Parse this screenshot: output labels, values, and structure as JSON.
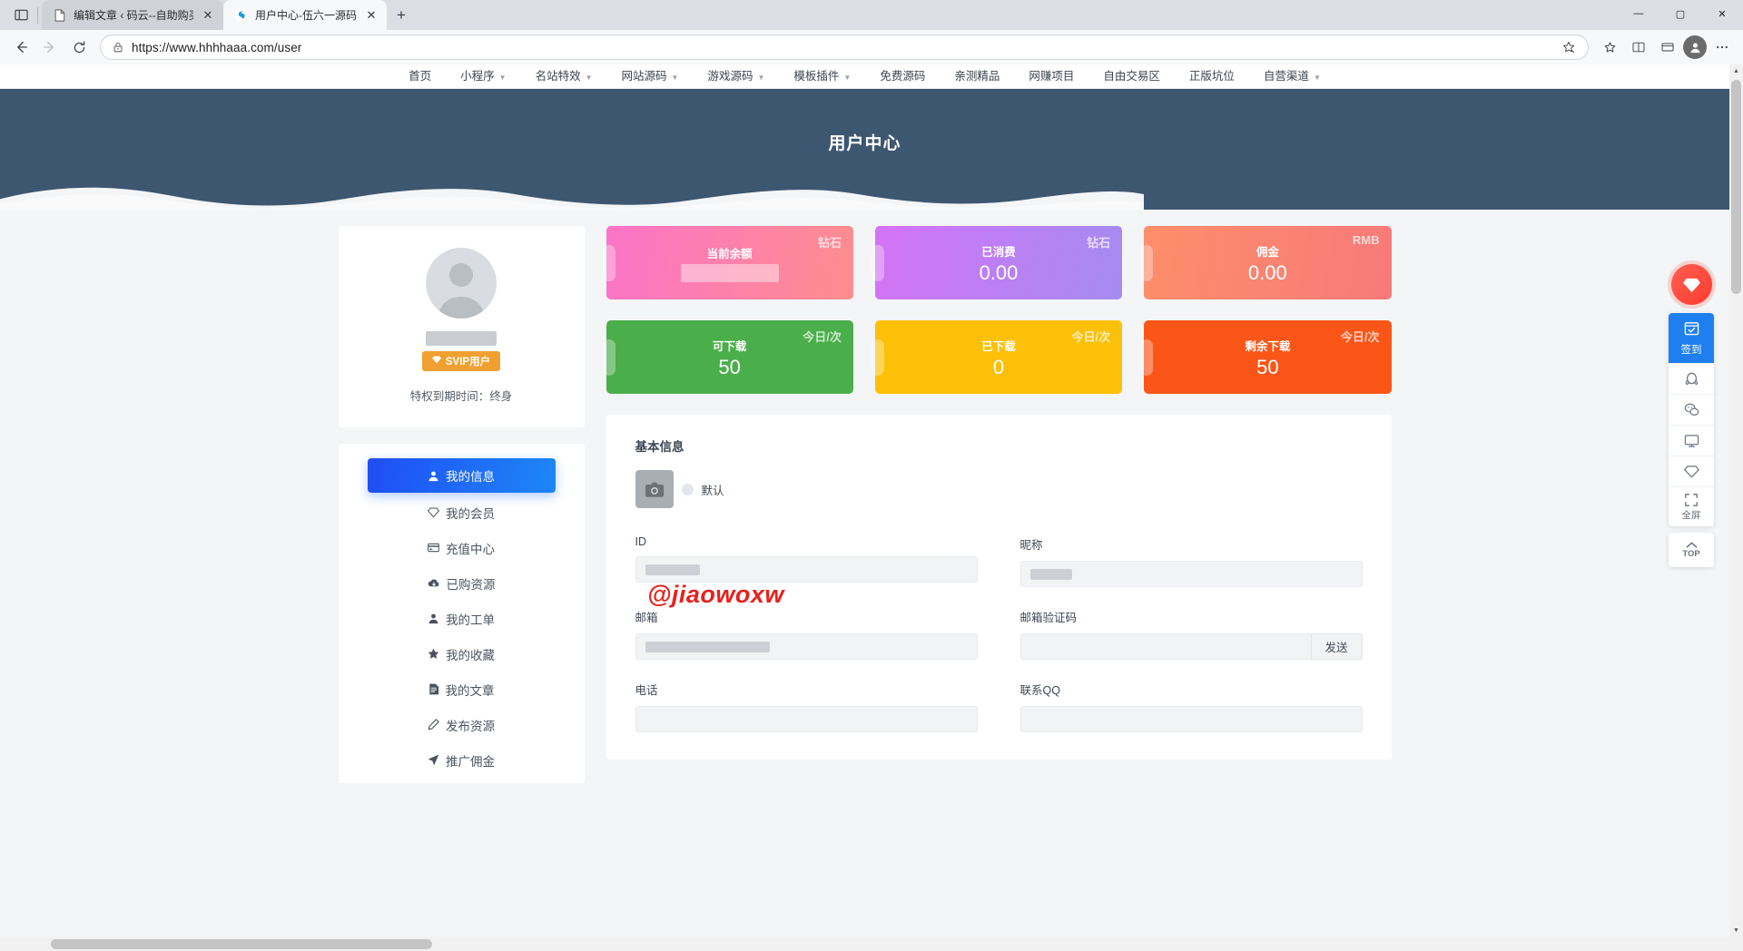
{
  "browser": {
    "tabs": [
      {
        "title": "编辑文章 ‹ 码云--自助购买资源平",
        "favicon": "page-icon",
        "active": false
      },
      {
        "title": "用户中心-伍六一源码",
        "favicon": "site-icon",
        "active": true
      }
    ],
    "new_tab_label": "+",
    "nav": {
      "back": "←",
      "forward": "→",
      "reload": "⟳"
    },
    "url": "https://www.hhhhaaa.com/user",
    "url_scheme": "https://",
    "url_host": "www.hhhhaaa.com",
    "url_path": "/user",
    "window_controls": {
      "minimize": "—",
      "maximize": "▢",
      "close": "✕"
    }
  },
  "sitenav": {
    "items": [
      {
        "label": "首页",
        "has_dropdown": false
      },
      {
        "label": "小程序",
        "has_dropdown": true
      },
      {
        "label": "名站特效",
        "has_dropdown": true
      },
      {
        "label": "网站源码",
        "has_dropdown": true
      },
      {
        "label": "游戏源码",
        "has_dropdown": true
      },
      {
        "label": "模板插件",
        "has_dropdown": true
      },
      {
        "label": "免费源码",
        "has_dropdown": false
      },
      {
        "label": "亲测精品",
        "has_dropdown": false
      },
      {
        "label": "网赚项目",
        "has_dropdown": false
      },
      {
        "label": "自由交易区",
        "has_dropdown": false
      },
      {
        "label": "正版坑位",
        "has_dropdown": false
      },
      {
        "label": "自营渠道",
        "has_dropdown": true
      }
    ]
  },
  "hero": {
    "title": "用户中心",
    "bg_color": "#3e5771"
  },
  "profile": {
    "name_masked": true,
    "badge_label": "SVIP用户",
    "badge_icon": "diamond-icon",
    "badge_color": "#f0a030",
    "expire_text": "特权到期时间：终身"
  },
  "menu": {
    "items": [
      {
        "label": "我的信息",
        "icon": "user-icon",
        "active": true
      },
      {
        "label": "我的会员",
        "icon": "diamond-icon",
        "active": false
      },
      {
        "label": "充值中心",
        "icon": "card-icon",
        "active": false
      },
      {
        "label": "已购资源",
        "icon": "cloud-download-icon",
        "active": false
      },
      {
        "label": "我的工单",
        "icon": "user-icon",
        "active": false
      },
      {
        "label": "我的收藏",
        "icon": "star-icon",
        "active": false
      },
      {
        "label": "我的文章",
        "icon": "file-icon",
        "active": false
      },
      {
        "label": "发布资源",
        "icon": "pencil-icon",
        "active": false
      },
      {
        "label": "推广佣金",
        "icon": "send-icon",
        "active": false
      }
    ],
    "active_gradient_from": "#1f4ef5",
    "active_gradient_to": "#1d86f7"
  },
  "stats": [
    {
      "label": "当前余额",
      "unit": "钻石",
      "value": "",
      "masked": true,
      "from": "#fb74c8",
      "to": "#fd8d8d"
    },
    {
      "label": "已消费",
      "unit": "钻石",
      "value": "0.00",
      "masked": false,
      "from": "#d474f5",
      "to": "#a58bf2"
    },
    {
      "label": "佣金",
      "unit": "RMB",
      "value": "0.00",
      "masked": false,
      "from": "#fd8e6a",
      "to": "#f77a7a"
    },
    {
      "label": "可下载",
      "unit": "今日/次",
      "value": "50",
      "masked": false,
      "from": "#47ac48",
      "to": "#4cb051"
    },
    {
      "label": "已下载",
      "unit": "今日/次",
      "value": "0",
      "masked": false,
      "from": "#fcbe07",
      "to": "#fdc40b"
    },
    {
      "label": "剩余下载",
      "unit": "今日/次",
      "value": "50",
      "masked": false,
      "from": "#fb5415",
      "to": "#fa5a1c"
    }
  ],
  "info": {
    "section_title": "基本信息",
    "avatar_icon": "camera-icon",
    "avatar_status": "默认",
    "fields": [
      {
        "label": "ID",
        "value": "",
        "masked": true,
        "placeholder": "",
        "button": null
      },
      {
        "label": "昵称",
        "value": "",
        "masked": true,
        "placeholder": "",
        "button": null
      },
      {
        "label": "邮箱",
        "value": "",
        "masked": true,
        "placeholder": "",
        "button": null
      },
      {
        "label": "邮箱验证码",
        "value": "",
        "masked": false,
        "placeholder": "",
        "button": "发送"
      },
      {
        "label": "电话",
        "value": "",
        "masked": false,
        "placeholder": "",
        "button": null
      },
      {
        "label": "联系QQ",
        "value": "",
        "masked": false,
        "placeholder": "",
        "button": null
      }
    ]
  },
  "watermark": {
    "text": "@jiaowoxw",
    "color": "#e8201c"
  },
  "floatbar": {
    "gem_icon": "diamond-icon",
    "sign_label": "签到",
    "sign_icon": "calendar-check-icon",
    "sign_color": "#1f7ff0",
    "items": [
      {
        "icon": "qq-icon",
        "label": ""
      },
      {
        "icon": "wechat-icon",
        "label": ""
      },
      {
        "icon": "monitor-icon",
        "label": ""
      },
      {
        "icon": "gem-icon",
        "label": ""
      },
      {
        "icon": "fullscreen-icon",
        "label": "全屏"
      }
    ],
    "top_label": "TOP",
    "top_icon": "chevron-up-icon"
  }
}
